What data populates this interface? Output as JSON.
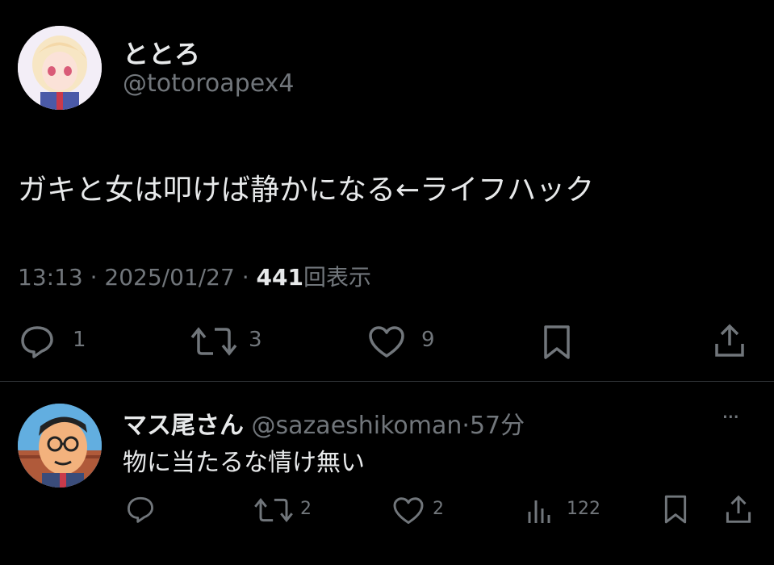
{
  "tweet": {
    "display_name": "ととろ",
    "handle": "@totoroapex4",
    "text": "ガキと女は叩けば静かになる←ライフハック",
    "time": "13:13",
    "dot1": "·",
    "date": "2025/01/27",
    "dot2": "·",
    "views_count": "441",
    "views_label": "回表示",
    "actions": {
      "reply_count": "1",
      "retweet_count": "3",
      "like_count": "9"
    }
  },
  "reply": {
    "display_name": "マス尾さん",
    "handle": "@sazaeshikoman",
    "dot": "·",
    "time_ago": "57分",
    "text": "物に当たるな情け無い",
    "actions": {
      "reply_count": "",
      "retweet_count": "2",
      "like_count": "2",
      "views_count": "122"
    },
    "more": "···"
  },
  "colors": {
    "background": "#000000",
    "text": "#e7e9ea",
    "muted": "#71767b",
    "divider": "#2f3336"
  }
}
